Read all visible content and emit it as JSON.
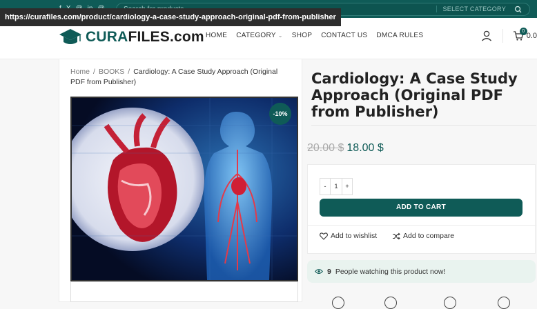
{
  "url_tooltip": "https://curafiles.com/product/cardiology-a-case-study-approach-original-pdf-from-publisher",
  "topbar": {
    "socials": [
      "f",
      "X",
      "@",
      "in",
      "@"
    ],
    "search_placeholder": "Search for products",
    "select_category": "SELECT CATEGORY"
  },
  "logo": {
    "text_a": "CURA",
    "text_b": "FILES.com"
  },
  "nav": {
    "items": [
      {
        "label": "HOME"
      },
      {
        "label": "CATEGORY"
      },
      {
        "label": "SHOP"
      },
      {
        "label": "CONTACT US"
      },
      {
        "label": "DMCA RULES"
      }
    ]
  },
  "cart": {
    "count": "0",
    "amount": "0.0"
  },
  "breadcrumb": {
    "home": "Home",
    "books": "BOOKS",
    "sep": "/",
    "current": "Cardiology: A Case Study Approach (Original PDF from Publisher)"
  },
  "product": {
    "discount": "-10%",
    "title": "Cardiology: A Case Study Approach (Original PDF from Publisher)",
    "old_price": "20.00 $",
    "new_price": "18.00 $",
    "qty_minus": "-",
    "qty_value": "1",
    "qty_plus": "+",
    "add_to_cart": "ADD TO CART",
    "wishlist": "Add to wishlist",
    "compare": "Add to compare",
    "watching_count": "9",
    "watching_text": "People watching this product now!"
  },
  "colors": {
    "brand": "#0f5b57",
    "watch_bg": "#e9f3ef"
  }
}
